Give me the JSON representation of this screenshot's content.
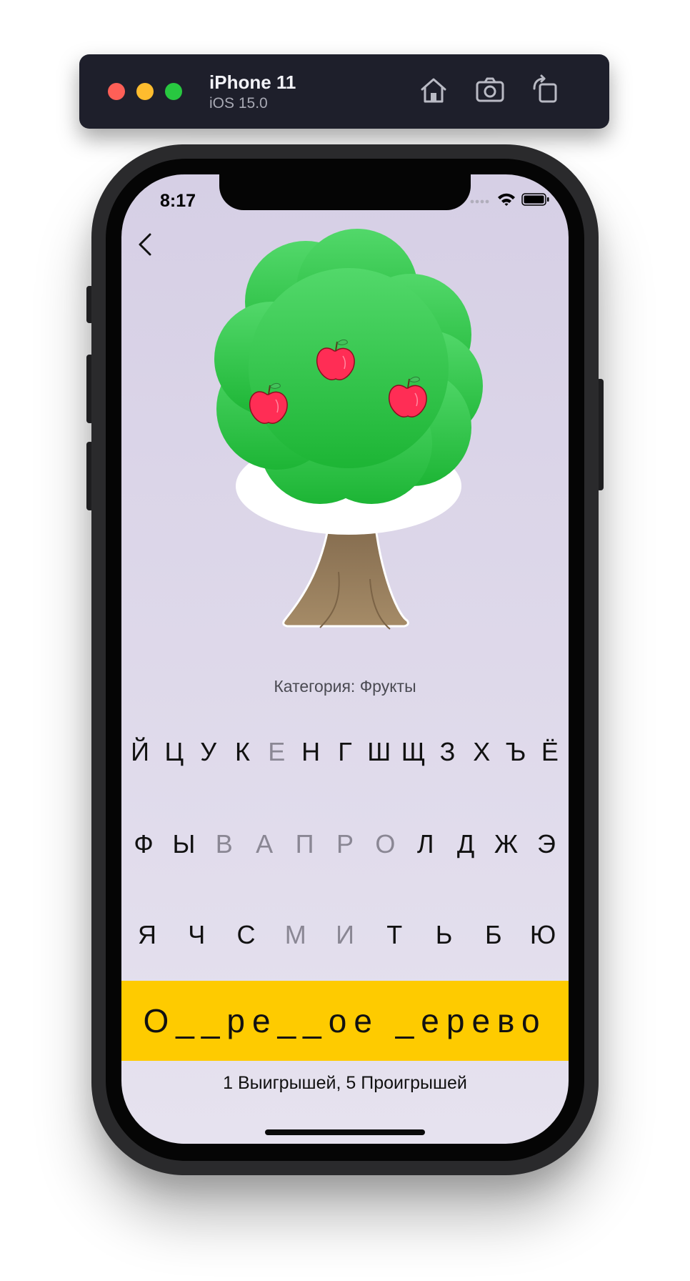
{
  "simulator": {
    "device_name": "iPhone 11",
    "os_version": "iOS 15.0",
    "icons": [
      "home-icon",
      "screenshot-icon",
      "rotate-icon"
    ],
    "traffic_light_colors": {
      "close": "#fe5f57",
      "minimize": "#febc2e",
      "zoom": "#28c840"
    }
  },
  "status_bar": {
    "time": "8:17",
    "icons": [
      "signal-icon",
      "wifi-icon",
      "battery-icon"
    ]
  },
  "app": {
    "back_icon": "chevron-left-icon",
    "illustration": "apple-tree",
    "apples_visible": 3,
    "category_text": "Категория: Фрукты",
    "keyboard": {
      "rows": [
        [
          {
            "letter": "Й",
            "used": false
          },
          {
            "letter": "Ц",
            "used": false
          },
          {
            "letter": "У",
            "used": false
          },
          {
            "letter": "К",
            "used": false
          },
          {
            "letter": "Е",
            "used": true
          },
          {
            "letter": "Н",
            "used": false
          },
          {
            "letter": "Г",
            "used": false
          },
          {
            "letter": "Ш",
            "used": false
          },
          {
            "letter": "Щ",
            "used": false
          },
          {
            "letter": "З",
            "used": false
          },
          {
            "letter": "Х",
            "used": false
          },
          {
            "letter": "Ъ",
            "used": false
          },
          {
            "letter": "Ё",
            "used": false
          }
        ],
        [
          {
            "letter": "Ф",
            "used": false
          },
          {
            "letter": "Ы",
            "used": false
          },
          {
            "letter": "В",
            "used": true
          },
          {
            "letter": "А",
            "used": true
          },
          {
            "letter": "П",
            "used": true
          },
          {
            "letter": "Р",
            "used": true
          },
          {
            "letter": "О",
            "used": true
          },
          {
            "letter": "Л",
            "used": false
          },
          {
            "letter": "Д",
            "used": false
          },
          {
            "letter": "Ж",
            "used": false
          },
          {
            "letter": "Э",
            "used": false
          }
        ],
        [
          {
            "letter": "Я",
            "used": false
          },
          {
            "letter": "Ч",
            "used": false
          },
          {
            "letter": "С",
            "used": false
          },
          {
            "letter": "М",
            "used": true
          },
          {
            "letter": "И",
            "used": true
          },
          {
            "letter": "Т",
            "used": false
          },
          {
            "letter": "Ь",
            "used": false
          },
          {
            "letter": "Б",
            "used": false
          },
          {
            "letter": "Ю",
            "used": false
          }
        ]
      ]
    },
    "masked_word": "О__ре__ое _ерево",
    "score_text": "1 Выигрышей, 5 Проигрышей",
    "colors": {
      "word_bar": "#fecb00",
      "leaf_green": "#34c759",
      "apple_red": "#ff2d55",
      "trunk_brown": "#8b6d4c",
      "used_letter": "#8a8794"
    }
  }
}
